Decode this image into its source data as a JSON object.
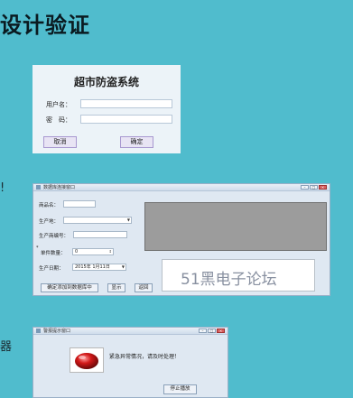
{
  "heading": "设计验证",
  "edge_marks": [
    "!",
    "器"
  ],
  "login": {
    "title": "超市防盗系统",
    "username_label": "用户名：",
    "password_label": "密　码：",
    "cancel_label": "取消",
    "ok_label": "确定"
  },
  "data_window": {
    "title": "数据库连接窗口",
    "window_buttons": [
      "–",
      "□",
      "×"
    ],
    "product_name_label": "商品名：",
    "origin_label": "生产地：",
    "maker_id_label": "生产商编号：",
    "stock_star": "*",
    "stock_label": "单件数量：",
    "stock_value": "0",
    "date_label": "生产日期：",
    "date_value": "2015年 1月11日",
    "add_button": "确定添加到数据库中",
    "show_button": "显示",
    "back_button": "返回",
    "watermark": "51黑电子论坛"
  },
  "alarm_window": {
    "title": "警报提示窗口",
    "window_buttons": [
      "–",
      "□",
      "×"
    ],
    "message": "紧急异常情况，请及时处理！",
    "stop_button": "停止播放"
  },
  "colors": {
    "background": "#50bccd",
    "dialog": "#ecf3f8",
    "window": "#dfe8f2",
    "gray_panel": "#9c9c9c"
  }
}
